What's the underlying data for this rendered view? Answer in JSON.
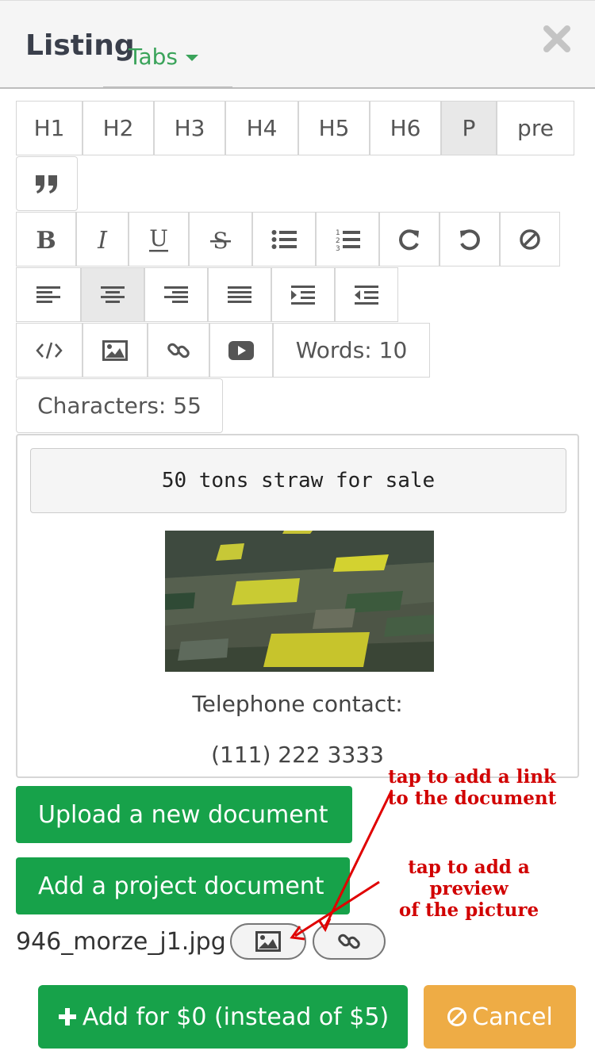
{
  "header": {
    "title": "Listing",
    "tabs_label": "Tabs",
    "close_icon": "close-icon"
  },
  "toolbar": {
    "headings": [
      "H1",
      "H2",
      "H3",
      "H4",
      "H5",
      "H6",
      "P",
      "pre"
    ],
    "active_heading": "P",
    "format_icons": [
      "bold-icon",
      "italic-icon",
      "underline-icon",
      "strikethrough-icon",
      "bullet-list-icon",
      "numbered-list-icon",
      "redo-icon",
      "undo-icon",
      "clear-format-icon"
    ],
    "align_icons": [
      "align-left-icon",
      "align-center-icon",
      "align-right-icon",
      "align-justify-icon",
      "indent-icon",
      "outdent-icon"
    ],
    "insert_icons": [
      "code-icon",
      "image-icon",
      "link-icon",
      "video-icon"
    ],
    "words": "Words: 10",
    "characters": "Characters: 55"
  },
  "editor": {
    "pre_text": "50 tons straw for sale",
    "line1": "Telephone contact:",
    "line2": "(111) 222 3333"
  },
  "documents": {
    "upload_label": "Upload a new document",
    "project_label": "Add a project document",
    "filename": "946_morze_j1.jpg"
  },
  "annotations": {
    "link_note_1": "tap to add a link",
    "link_note_2": "to the document",
    "preview_note_1": "tap to add a preview",
    "preview_note_2": "of the picture"
  },
  "actions": {
    "add_label": "Add for $0 (instead of $5)",
    "cancel_label": "Cancel"
  },
  "colors": {
    "primary_green": "#17a24a",
    "tab_green": "#3aa35a",
    "cancel_orange": "#eeac45",
    "annotation_red": "#d10000"
  }
}
